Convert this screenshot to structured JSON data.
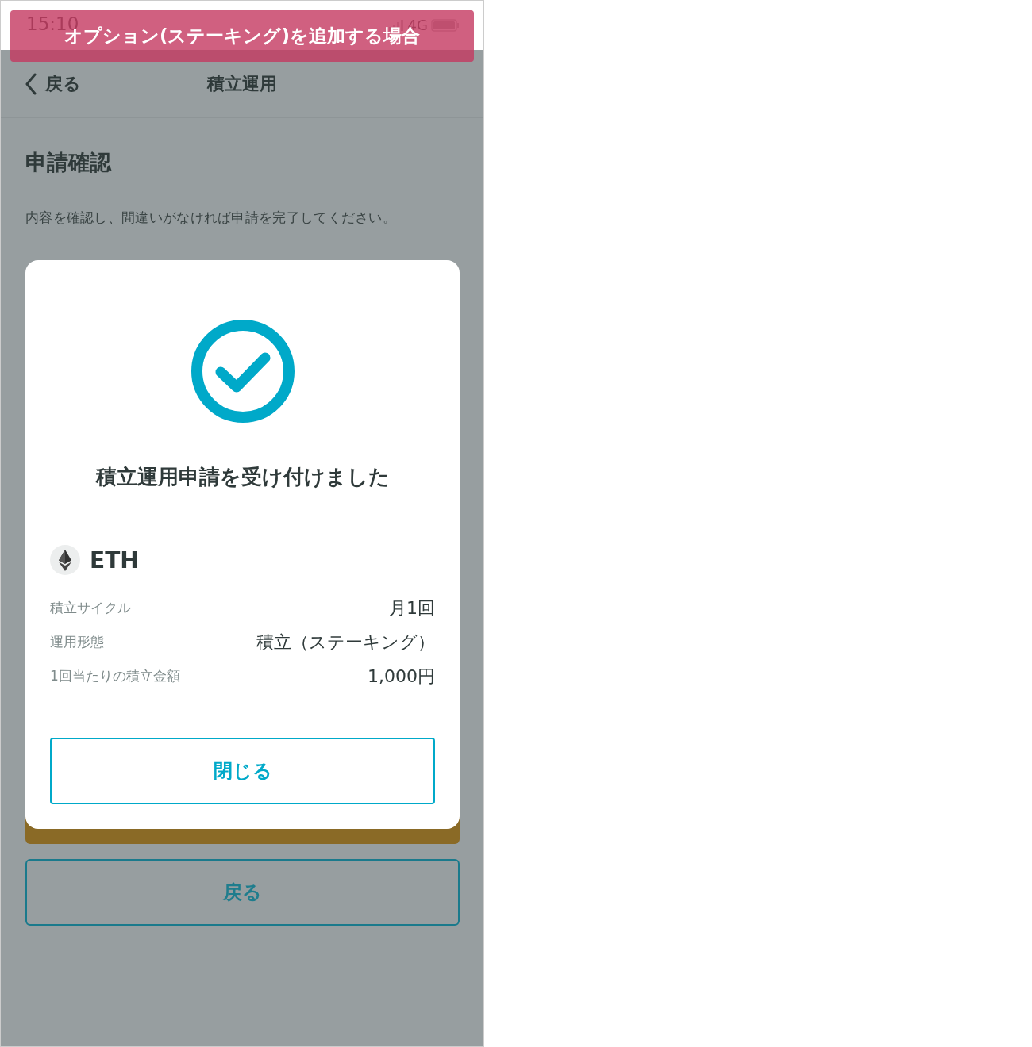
{
  "banner": "オプション(ステーキング)を追加する場合",
  "status_bar": {
    "time": "15:10",
    "network": "4G"
  },
  "nav": {
    "back": "戻る",
    "title": "積立運用"
  },
  "page": {
    "heading": "申請確認",
    "description": "内容を確認し、間違いがなければ申請を完了してください。"
  },
  "dialog": {
    "title": "積立運用申請を受け付けました",
    "coin": "ETH",
    "rows": [
      {
        "label": "積立サイクル",
        "value": "月1回"
      },
      {
        "label": "運用形態",
        "value": "積立（ステーキング）"
      },
      {
        "label": "1回当たりの積立金額",
        "value": "1,000円"
      }
    ],
    "close_button": "閉じる"
  },
  "back_button": "戻る"
}
